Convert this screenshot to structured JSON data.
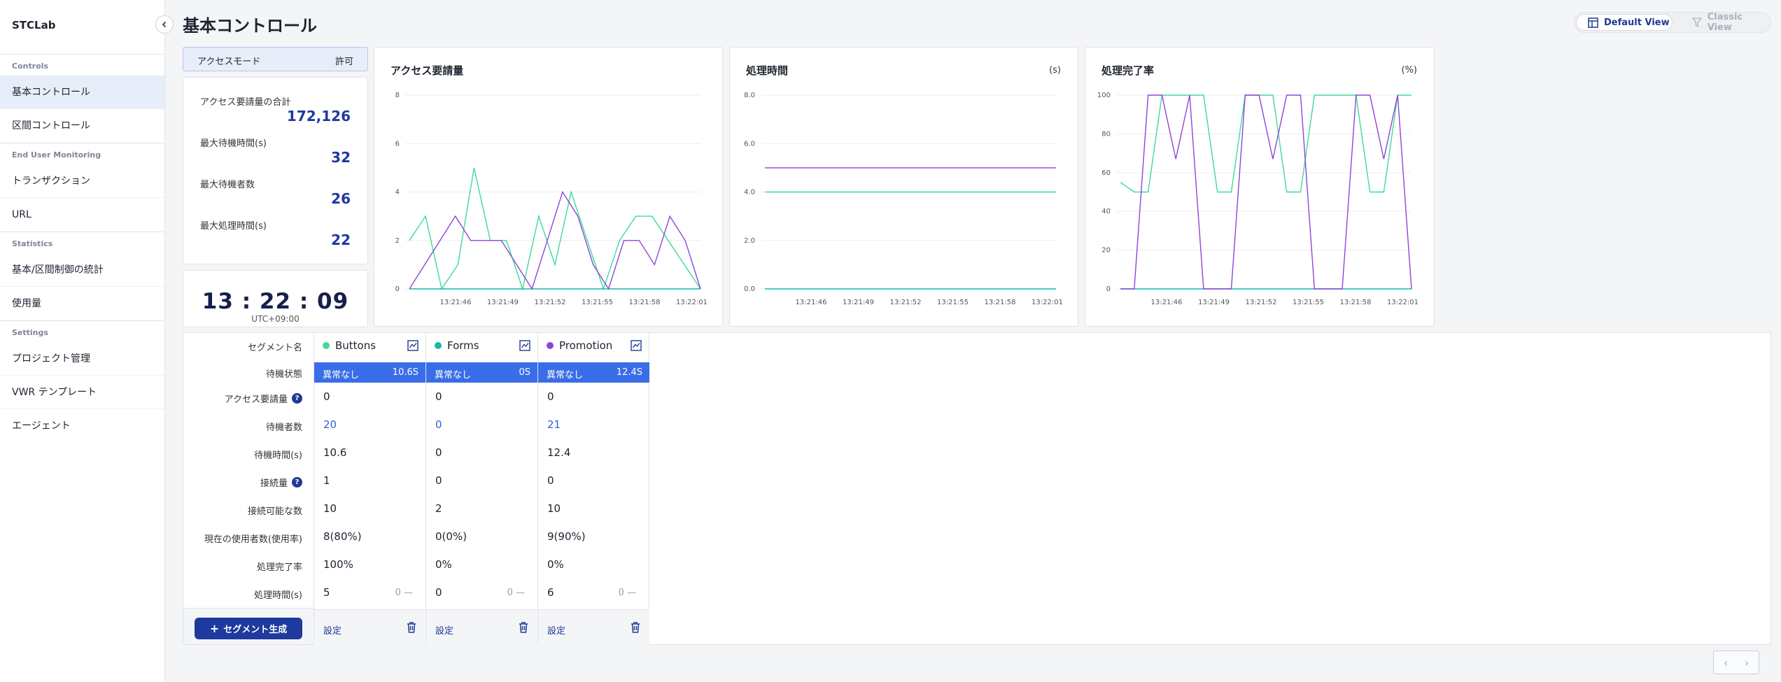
{
  "sidebar": {
    "brand": "STCLab",
    "sections": [
      {
        "title": "Controls",
        "items": [
          "基本コントロール",
          "区間コントロール"
        ]
      },
      {
        "title": "End User Monitoring",
        "items": [
          "トランザクション",
          "URL"
        ]
      },
      {
        "title": "Statistics",
        "items": [
          "基本/区間制御の統計",
          "使用量"
        ]
      },
      {
        "title": "Settings",
        "items": [
          "プロジェクト管理",
          "VWR テンプレート",
          "エージェント"
        ]
      }
    ],
    "active": "基本コントロール"
  },
  "header": {
    "title": "基本コントロール",
    "default_view": "Default View",
    "classic_view": "Classic View"
  },
  "access_mode": {
    "label": "アクセスモード",
    "value": "許可"
  },
  "stats": [
    {
      "label": "アクセス要請量の合計",
      "value": "172,126"
    },
    {
      "label": "最大待機時間(s)",
      "value": "32"
    },
    {
      "label": "最大待機者数",
      "value": "26"
    },
    {
      "label": "最大処理時間(s)",
      "value": "22"
    }
  ],
  "clock": {
    "time": "13 : 22 : 09",
    "timezone": "UTC+09:00"
  },
  "colors": {
    "buttons": "#3ddc97",
    "forms": "#17b8a6",
    "promotion": "#8e44d8",
    "accent": "#1e3a9e",
    "status": "#3a6ee8"
  },
  "chart_data": [
    {
      "type": "line",
      "title": "アクセス要請量",
      "unit": "",
      "x": [
        "13:21:46",
        "13:21:49",
        "13:21:52",
        "13:21:55",
        "13:21:58",
        "13:22:01"
      ],
      "ylim": [
        0,
        8
      ],
      "yticks": [
        "0",
        "2",
        "4",
        "6",
        "8"
      ],
      "series": [
        {
          "name": "Buttons",
          "color": "#3ddc97",
          "values": [
            2,
            3,
            0,
            1,
            5,
            2,
            2,
            0,
            3,
            1,
            4,
            2,
            0,
            2,
            3,
            3,
            2,
            1,
            0
          ]
        },
        {
          "name": "Forms",
          "color": "#17b8a6",
          "values": [
            0,
            0,
            0,
            0,
            0,
            0,
            0,
            0,
            0,
            0,
            0,
            0,
            0,
            0,
            0,
            0,
            0,
            0,
            0
          ]
        },
        {
          "name": "Promotion",
          "color": "#8e44d8",
          "values": [
            0,
            1,
            2,
            3,
            2,
            2,
            2,
            1,
            0,
            2,
            4,
            3,
            1,
            0,
            2,
            2,
            1,
            3,
            2,
            0
          ]
        }
      ]
    },
    {
      "type": "line",
      "title": "処理時間",
      "unit": "(s)",
      "x": [
        "13:21:46",
        "13:21:49",
        "13:21:52",
        "13:21:55",
        "13:21:58",
        "13:22:01"
      ],
      "ylim": [
        0,
        8
      ],
      "yticks": [
        "0.0",
        "2.0",
        "4.0",
        "6.0",
        "8.0"
      ],
      "series": [
        {
          "name": "Buttons",
          "color": "#3ddc97",
          "values": [
            4,
            4
          ]
        },
        {
          "name": "Forms",
          "color": "#17b8a6",
          "values": [
            0,
            0
          ]
        },
        {
          "name": "Promotion",
          "color": "#8e44d8",
          "values": [
            5,
            5
          ]
        }
      ]
    },
    {
      "type": "line",
      "title": "処理完了率",
      "unit": "(%)",
      "x": [
        "13:21:46",
        "13:21:49",
        "13:21:52",
        "13:21:55",
        "13:21:58",
        "13:22:01"
      ],
      "ylim": [
        0,
        100
      ],
      "yticks": [
        "0",
        "20",
        "40",
        "60",
        "80",
        "100"
      ],
      "series": [
        {
          "name": "Buttons",
          "color": "#3ddc97",
          "values": [
            55,
            50,
            50,
            100,
            100,
            100,
            100,
            50,
            50,
            100,
            100,
            100,
            50,
            50,
            100,
            100,
            100,
            100,
            50,
            50,
            100,
            100
          ]
        },
        {
          "name": "Forms",
          "color": "#17b8a6",
          "values": [
            0,
            0,
            0,
            0,
            0,
            0,
            0,
            0,
            0,
            0,
            0,
            0,
            0,
            0,
            0,
            0,
            0,
            0,
            0,
            0,
            0,
            0
          ]
        },
        {
          "name": "Promotion",
          "color": "#8e44d8",
          "values": [
            0,
            0,
            100,
            100,
            67,
            100,
            0,
            0,
            0,
            100,
            100,
            67,
            100,
            100,
            0,
            0,
            0,
            100,
            100,
            67,
            100,
            0
          ]
        }
      ]
    }
  ],
  "segments": {
    "row_labels": [
      "セグメント名",
      "待機状態",
      "アクセス要請量",
      "待機者数",
      "待機時間(s)",
      "接続量",
      "接続可能な数",
      "現在の使用者数(使用率)",
      "処理完了率",
      "処理時間(s)"
    ],
    "create_button": "セグメント生成",
    "settings_label": "設定",
    "columns": [
      {
        "name": "Buttons",
        "color": "#3ddc97",
        "status": "異常なし",
        "status_time": "10.6S",
        "requests": "0",
        "waiting": "20",
        "wait_time": "10.6",
        "connections": "1",
        "capacity": "10",
        "current_users": "8(80%)",
        "completion": "100%",
        "proc_time": "5",
        "proc_extra": "0 —"
      },
      {
        "name": "Forms",
        "color": "#17b8a6",
        "status": "異常なし",
        "status_time": "0S",
        "requests": "0",
        "waiting": "0",
        "wait_time": "0",
        "connections": "0",
        "capacity": "2",
        "current_users": "0(0%)",
        "completion": "0%",
        "proc_time": "0",
        "proc_extra": "0 —"
      },
      {
        "name": "Promotion",
        "color": "#8e44d8",
        "status": "異常なし",
        "status_time": "12.4S",
        "requests": "0",
        "waiting": "21",
        "wait_time": "12.4",
        "connections": "0",
        "capacity": "10",
        "current_users": "9(90%)",
        "completion": "0%",
        "proc_time": "6",
        "proc_extra": "0 —"
      }
    ]
  },
  "pager": {
    "prev": "‹",
    "next": "›"
  }
}
